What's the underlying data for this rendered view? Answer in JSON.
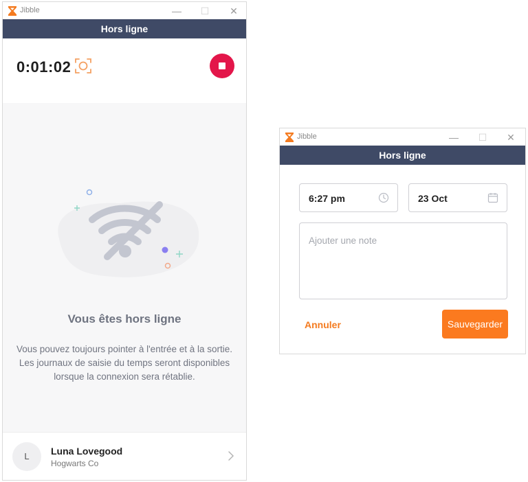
{
  "main_window": {
    "app_name": "Jibble",
    "controls": {
      "minimize": "—",
      "maximize": "☐",
      "close": "✕"
    },
    "status": "Hors ligne",
    "timer": "0:01:02",
    "offline_title": "Vous êtes hors ligne",
    "offline_message_lines": [
      "Vous pouvez toujours pointer à l'entrée et à la sortie.",
      "Les journaux de saisie du temps seront disponibles",
      "lorsque la connexion sera rétablie."
    ],
    "user": {
      "initial": "L",
      "name": "Luna Lovegood",
      "organization": "Hogwarts Co"
    },
    "icons": {
      "logo": "jibble-logo",
      "focus": "focus-scan-icon",
      "stop": "stop-icon",
      "illustration": "wifi-off-icon",
      "chevron": "chevron-right-icon"
    }
  },
  "entry_window": {
    "app_name": "Jibble",
    "controls": {
      "minimize": "—",
      "maximize": "☐",
      "close": "✕"
    },
    "status": "Hors ligne",
    "time_value": "6:27 pm",
    "date_value": "23 Oct",
    "note_placeholder": "Ajouter une note",
    "cancel_label": "Annuler",
    "save_label": "Sauvegarder",
    "icons": {
      "time": "clock-icon",
      "date": "calendar-icon"
    }
  },
  "colors": {
    "status_bar": "#3f4a66",
    "brand_orange": "#fb7a1f",
    "stop_red": "#e3164a"
  }
}
